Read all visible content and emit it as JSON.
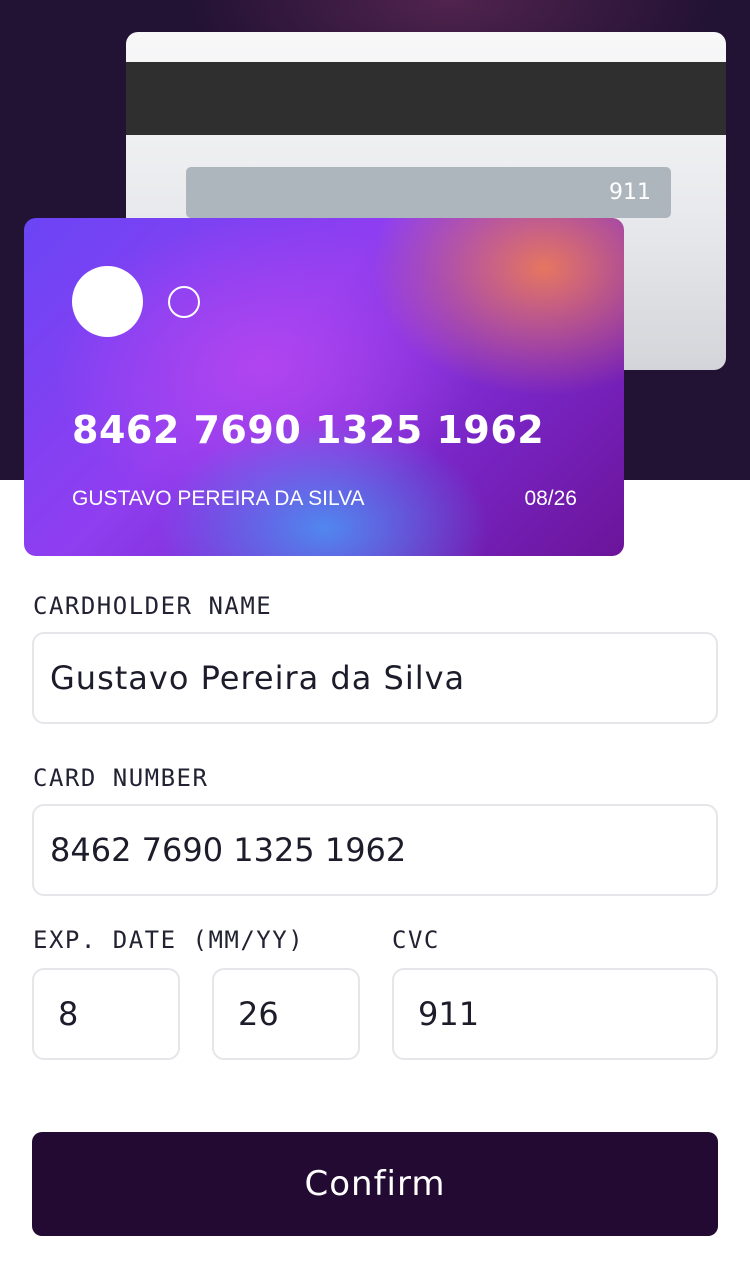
{
  "card_back": {
    "cvc": "911"
  },
  "card_front": {
    "number": "8462 7690 1325 1962",
    "holder": "GUSTAVO PEREIRA DA SILVA",
    "expiry": "08/26"
  },
  "form": {
    "name_label": "CARDHOLDER NAME",
    "name_value": "Gustavo Pereira da Silva",
    "number_label": "CARD NUMBER",
    "number_value": "8462 7690 1325 1962",
    "exp_label": "EXP. DATE (MM/YY)",
    "exp_month": "8",
    "exp_year": "26",
    "cvc_label": "CVC",
    "cvc_value": "911"
  },
  "actions": {
    "confirm_label": "Confirm"
  },
  "colors": {
    "background_dark": "#221233",
    "button": "#220a32",
    "input_border": "#e6e6ea"
  }
}
